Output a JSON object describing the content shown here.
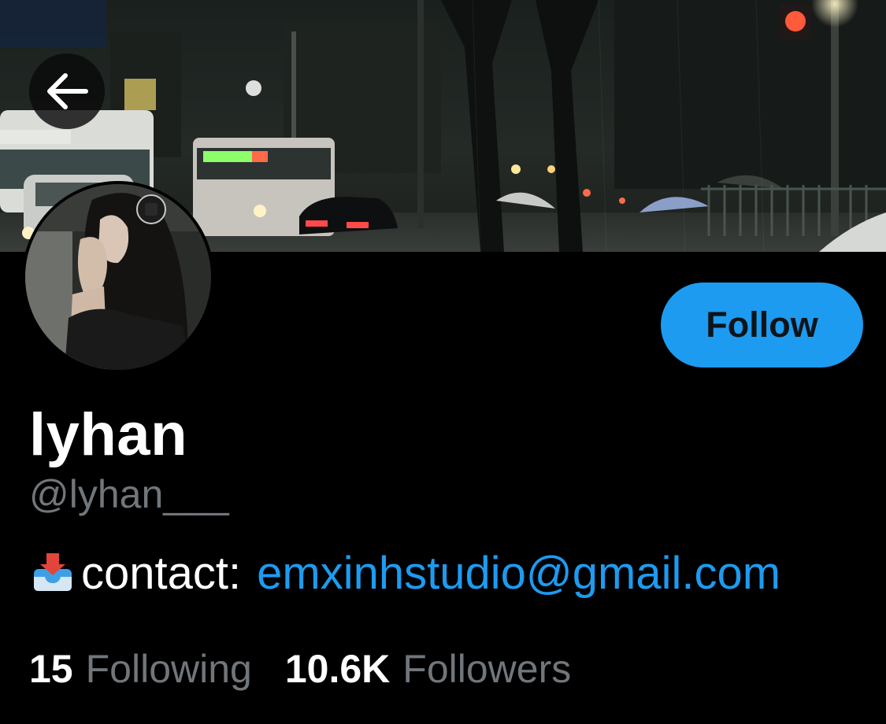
{
  "profile": {
    "display_name": "lyhan",
    "handle": "@lyhan___",
    "bio": {
      "icon": "inbox-tray-icon",
      "label": "contact:",
      "email": "emxinhstudio@gmail.com"
    },
    "stats": {
      "following_count": "15",
      "following_label": "Following",
      "followers_count": "10.6K",
      "followers_label": "Followers"
    }
  },
  "actions": {
    "follow_label": "Follow",
    "back_icon": "back-arrow-icon"
  },
  "colors": {
    "background": "#000000",
    "accent": "#1d9bf0",
    "secondary_text": "#71767b",
    "primary_text": "#ffffff",
    "button_text": "#0f1419"
  }
}
